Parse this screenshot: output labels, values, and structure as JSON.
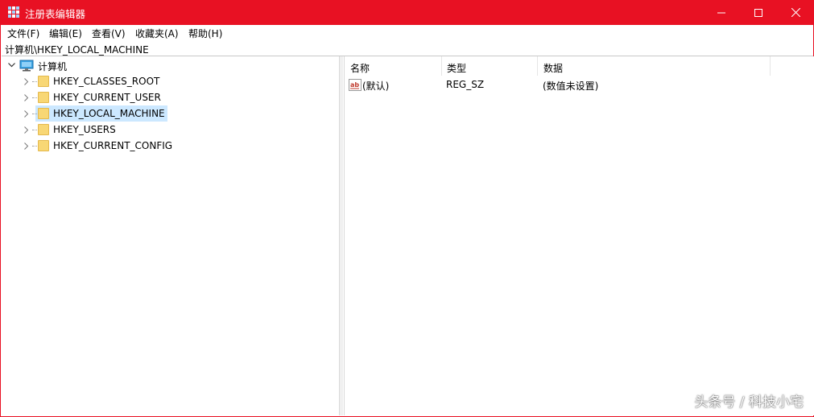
{
  "window": {
    "title": "注册表编辑器",
    "accent_color": "#e81123",
    "controls": {
      "minimize_icon": "minimize-icon",
      "maximize_icon": "maximize-icon",
      "close_icon": "close-icon"
    }
  },
  "menu": {
    "items": [
      {
        "label": "文件(F)"
      },
      {
        "label": "编辑(E)"
      },
      {
        "label": "查看(V)"
      },
      {
        "label": "收藏夹(A)"
      },
      {
        "label": "帮助(H)"
      }
    ]
  },
  "address": {
    "path": "计算机\\HKEY_LOCAL_MACHINE"
  },
  "tree": {
    "root": {
      "label": "计算机",
      "icon": "computer-icon",
      "expanded": true
    },
    "keys": [
      {
        "label": "HKEY_CLASSES_ROOT",
        "selected": false
      },
      {
        "label": "HKEY_CURRENT_USER",
        "selected": false
      },
      {
        "label": "HKEY_LOCAL_MACHINE",
        "selected": true
      },
      {
        "label": "HKEY_USERS",
        "selected": false
      },
      {
        "label": "HKEY_CURRENT_CONFIG",
        "selected": false
      }
    ],
    "selection_color": "#cce8ff"
  },
  "list": {
    "columns": [
      {
        "label": "名称"
      },
      {
        "label": "类型"
      },
      {
        "label": "数据"
      }
    ],
    "rows": [
      {
        "icon": "string-value-icon",
        "name": "(默认)",
        "type": "REG_SZ",
        "data": "(数值未设置)"
      }
    ]
  },
  "watermark": {
    "text": "头条号 / 科技小宅"
  }
}
